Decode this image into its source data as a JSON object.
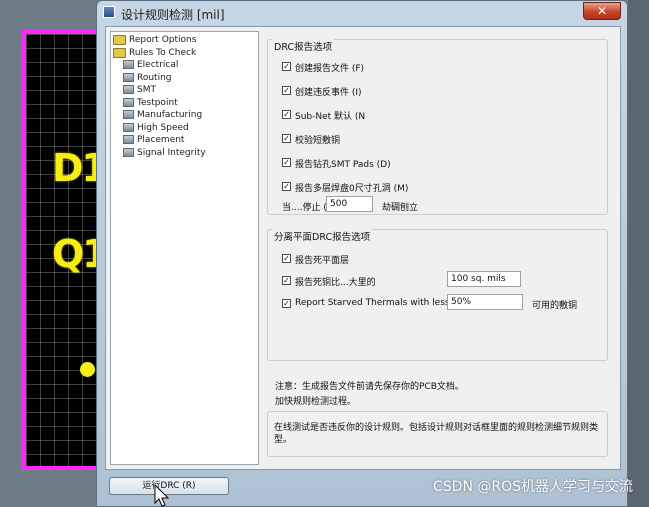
{
  "pcb": {
    "labels": [
      "D1",
      "Q1"
    ]
  },
  "dialog": {
    "title": "设计规则检测 [mil]",
    "close_label": "✕"
  },
  "tree": {
    "items": [
      {
        "label": "Report Options",
        "icon": "folder-icon"
      },
      {
        "label": "Rules To Check",
        "icon": "folder-icon"
      },
      {
        "label": "Electrical",
        "icon": "electrical-icon"
      },
      {
        "label": "Routing",
        "icon": "routing-icon"
      },
      {
        "label": "SMT",
        "icon": "smt-icon"
      },
      {
        "label": "Testpoint",
        "icon": "testpoint-icon"
      },
      {
        "label": "Manufacturing",
        "icon": "manufacturing-icon"
      },
      {
        "label": "High Speed",
        "icon": "highspeed-icon"
      },
      {
        "label": "Placement",
        "icon": "placement-icon"
      },
      {
        "label": "Signal Integrity",
        "icon": "signal-integrity-icon"
      }
    ]
  },
  "drc_options": {
    "title": "DRC报告选项",
    "create_report": "创建报告文件 (F)",
    "create_violations": "创建违反事件 (I)",
    "subnet_default": "Sub-Net 默认 (N",
    "verify_shorting": "校验短敷铜",
    "report_drilled": "报告钻孔SMT Pads (D)",
    "report_multilayer": "报告多层焊盘0尺寸孔洞 (M)",
    "stop_label": "当....停止 (I",
    "stop_value": "500",
    "stop_suffix": "劫碉刨立"
  },
  "split_plane": {
    "title": "分离平面DRC报告选项",
    "dead_plane": "报告死平面层",
    "dead_copper": "报告死铜比...大里的",
    "dead_copper_value": "100 sq. mils",
    "starved_thermals": "Report Starved Thermals with less than",
    "starved_value": "50%",
    "starved_suffix": "可用的敷铜"
  },
  "notes": {
    "line1": "注意：生成报告文件前请先保存你的PCB文档。",
    "line2": "加快规则检测过程。",
    "desc": "在线测试是否违反你的设计规则。包括设计规则对话框里面的规则检测细节规则类型。"
  },
  "run_button": "运行DRC (R)",
  "watermark": "CSDN @ROS机器人学习与交流"
}
